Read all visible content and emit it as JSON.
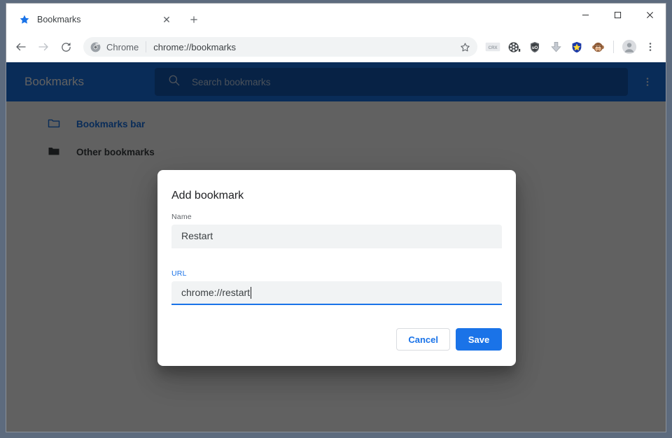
{
  "window": {
    "controls": {
      "minimize": "—",
      "maximize": "□",
      "close": "✕"
    }
  },
  "tabstrip": {
    "tab": {
      "title": "Bookmarks",
      "favicon": "star-icon",
      "close_label": "✕"
    },
    "new_tab_label": "+"
  },
  "toolbar": {
    "back_label": "←",
    "forward_label": "→",
    "reload_label": "↻",
    "omnibox": {
      "chrome_label": "Chrome",
      "url": "chrome://bookmarks",
      "star_label": "☆"
    },
    "extensions": [
      {
        "name": "crx-extension-icon",
        "label": "CRX"
      },
      {
        "name": "film-reel-extension-icon",
        "label": "🎞"
      },
      {
        "name": "ublock-origin-extension-icon",
        "label": "uO"
      },
      {
        "name": "download-arrow-extension-icon",
        "label": "⬇"
      },
      {
        "name": "star-badge-extension-icon",
        "label": "★"
      },
      {
        "name": "monkey-extension-icon",
        "label": "🙈"
      }
    ],
    "profile_label": "profile-avatar",
    "menu_label": "⋮"
  },
  "bookmark_manager": {
    "title": "Bookmarks",
    "search_placeholder": "Search bookmarks",
    "menu_label": "⋮",
    "accent_color": "#1a73e8",
    "folders": [
      {
        "label": "Bookmarks bar",
        "icon": "folder-outline-icon",
        "selected": true
      },
      {
        "label": "Other bookmarks",
        "icon": "folder-filled-icon",
        "selected": false
      }
    ],
    "obscured_item_text": "ss bar"
  },
  "dialog": {
    "title": "Add bookmark",
    "name_field": {
      "label": "Name",
      "value": "Restart",
      "focused": false
    },
    "url_field": {
      "label": "URL",
      "value": "chrome://restart",
      "focused": true
    },
    "cancel_label": "Cancel",
    "save_label": "Save"
  }
}
